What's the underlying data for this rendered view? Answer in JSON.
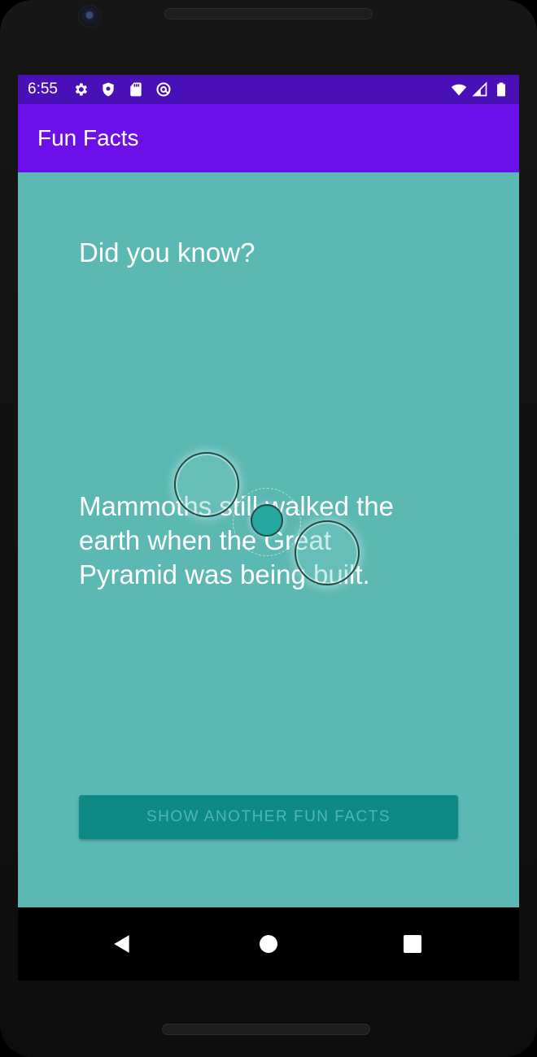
{
  "status_bar": {
    "time": "6:55",
    "left_icons": [
      "gear-icon",
      "shield-icon",
      "sd-card-icon",
      "at-sign-icon"
    ],
    "right_icons": [
      "wifi-icon",
      "signal-icon",
      "battery-icon"
    ]
  },
  "app_bar": {
    "title": "Fun Facts"
  },
  "content": {
    "heading": "Did you know?",
    "fact": "Mammoths still walked the earth when the Great Pyramid was being built.",
    "button_label": "SHOW ANOTHER FUN FACTS"
  },
  "nav_bar": {
    "buttons": [
      "back-icon",
      "home-icon",
      "recents-icon"
    ]
  },
  "colors": {
    "status_bar": "#4a10b8",
    "app_bar": "#6b10e8",
    "background": "#5bb8b3",
    "button": "#0e8a84",
    "button_text": "#4fb7b0"
  }
}
